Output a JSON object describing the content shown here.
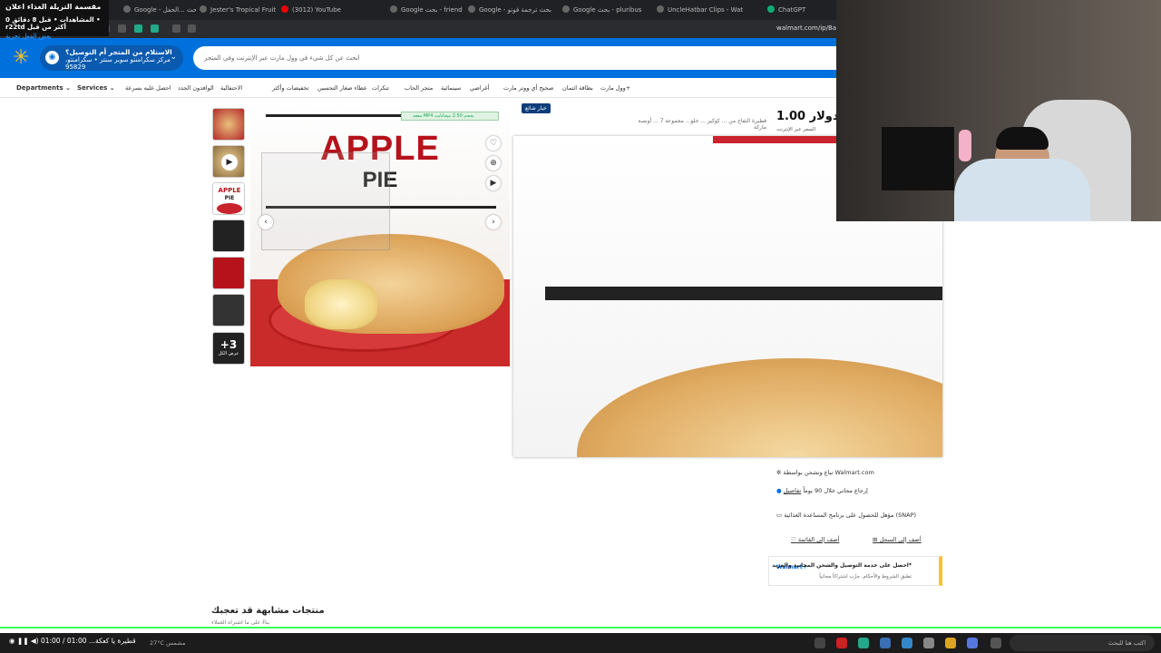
{
  "notification": {
    "title": "مقسمة التزيلة الغذاء اعلان",
    "line2": "المشاهدات • قبل 8 دقائق 0 • r22td أكثر من قبل",
    "line3": "بعض الفعل تجربة"
  },
  "tabs": [
    {
      "label": "Google - بحث ...الحفل"
    },
    {
      "label": "Jester's Tropical Fruit Fam"
    },
    {
      "label": "(3012) YouTube"
    },
    {
      "label": "Google بحث - friends"
    },
    {
      "label": "Google - بحث ترجمة فوتو"
    },
    {
      "label": "Google بحث - pluribus"
    },
    {
      "label": "UncleHatbar Clips - Wat"
    },
    {
      "label": "ChatGPT"
    }
  ],
  "browser": {
    "url": "walmart.com/ip/Banc"
  },
  "header": {
    "delivery_title": "الاستلام من المتجر أم التوصيل؟",
    "delivery_sub": "مركز سكرامنتو سوبر سنتر • سكرامنتو، 95829",
    "search_placeholder": "ابحث عن كل شيء في وول مارت عبر الإنترنت وفي المتجر"
  },
  "nav": {
    "departments": "Departments",
    "services": "Services",
    "items": [
      "احصل عليه بسرعة",
      "الوافدون الجدد",
      "الاحتفالية",
      "تخفيضات وأكثر",
      "عطاء صغار التحسين",
      "تنكرات",
      "متجر الحاب",
      "سينمائية",
      "أغراضي",
      "صحيح أي ووتر مارت",
      "بطاقة ائتمان",
      "وول مارت+"
    ]
  },
  "product": {
    "hero_title": "APPLE",
    "hero_subtitle": "PIE",
    "price_pill": "مقعد MP4 بحجم 2.50 ميجابايت",
    "thumb_more": "+3",
    "thumb_more_label": "عرض الكل",
    "badge": "خيار شائع",
    "title": "فطيرة التفاح من ... كوكيز ... حلو... مجموعة 7 ... أونصة",
    "brand": "ماركة",
    "price": "1.00 دولار",
    "price_note": "السعر عبر الإنترنت",
    "sold_by": "تباع وتشحن بواسطة Walmart.com",
    "returns": "إرجاع مجاني خلال 90 يوماً",
    "returns_link": "تفاصيل",
    "snap": "مؤهل للحصول على برنامج المساعدة الغذائية (SNAP)",
    "add_list": "أضف إلى القائمة",
    "add_registry": "أضف إلى السجل",
    "wplus_logo": "Walmart+",
    "wplus_title": "احصل على خدمة التوصيل والشحن المجانية والمزيد*",
    "wplus_sub": "تطبق الشروط والأحكام. جرّب اشتراكاً مجانياً"
  },
  "similar": {
    "title": "منتجات مشابهة قد تعجبك",
    "sub": "بناءً على ما اشتراه العملاء"
  },
  "taskbar": {
    "player": "01:00 / 01:00 ...قطيرة يا كعكة",
    "weather": "27°C مشمس",
    "search_placeholder": "اكتب هنا للبحث"
  }
}
